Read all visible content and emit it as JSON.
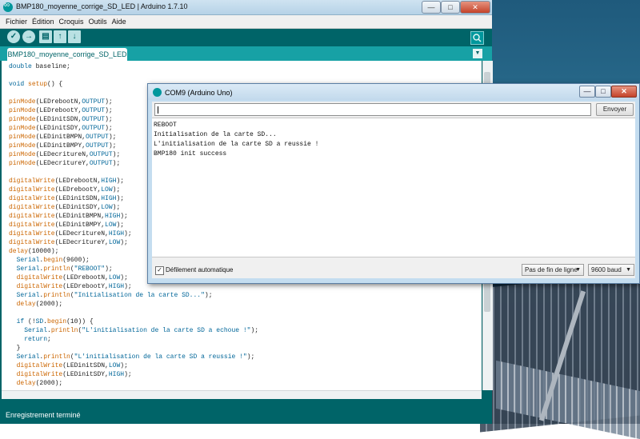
{
  "ide": {
    "title": "BMP180_moyenne_corrige_SD_LED | Arduino 1.7.10",
    "window_buttons": [
      "—",
      "□",
      "✕"
    ],
    "menu": [
      "Fichier",
      "Édition",
      "Croquis",
      "Outils",
      "Aide"
    ],
    "toolbar_icons": [
      "verify-icon",
      "upload-icon",
      "new-icon",
      "open-icon",
      "save-icon",
      "serial-monitor-icon"
    ],
    "tab_label": "BMP180_moyenne_corrige_SD_LED",
    "code_lines": [
      "double baseline;",
      "",
      "void setup() {",
      "",
      "pinMode(LEDrebootN,OUTPUT);",
      "pinMode(LEDrebootY,OUTPUT);",
      "pinMode(LEDinitSDN,OUTPUT);",
      "pinMode(LEDinitSDY,OUTPUT);",
      "pinMode(LEDinitBMPN,OUTPUT);",
      "pinMode(LEDinitBMPY,OUTPUT);",
      "pinMode(LEDecritureN,OUTPUT);",
      "pinMode(LEDecritureY,OUTPUT);",
      "",
      "digitalWrite(LEDrebootN,HIGH);",
      "digitalWrite(LEDrebootY,LOW);",
      "digitalWrite(LEDinitSDN,HIGH);",
      "digitalWrite(LEDinitSDY,LOW);",
      "digitalWrite(LEDinitBMPN,HIGH);",
      "digitalWrite(LEDinitBMPY,LOW);",
      "digitalWrite(LEDecritureN,HIGH);",
      "digitalWrite(LEDecritureY,LOW);",
      "delay(10000);",
      "  Serial.begin(9600);",
      "  Serial.println(\"REBOOT\");",
      "  digitalWrite(LEDrebootN,LOW);",
      "  digitalWrite(LEDrebootY,HIGH);",
      "  Serial.println(\"Initialisation de la carte SD...\");",
      "  delay(2000);",
      "",
      "  if (!SD.begin(10)) {",
      "    Serial.println(\"L'initialisation de la carte SD a echoue !\");",
      "    return;",
      "  }",
      "  Serial.println(\"L'initialisation de la carte SD a reussie !\");",
      "  digitalWrite(LEDinitSDN,LOW);",
      "  digitalWrite(LEDinitSDY,HIGH);",
      "  delay(2000);"
    ],
    "status": "Enregistrement terminé"
  },
  "serial": {
    "title": "COM9 (Arduino Uno)",
    "window_buttons": [
      "—",
      "□",
      "✕"
    ],
    "input_value": "",
    "send_label": "Envoyer",
    "output_lines": [
      "REBOOT",
      "Initialisation de la carte SD...",
      "L'initialisation de la carte SD a reussie !",
      "BMP180 init success"
    ],
    "autoscroll_label": "Défilement automatique",
    "autoscroll_checked": true,
    "line_ending": "Pas de fin de ligne",
    "baud": "9600 baud"
  }
}
